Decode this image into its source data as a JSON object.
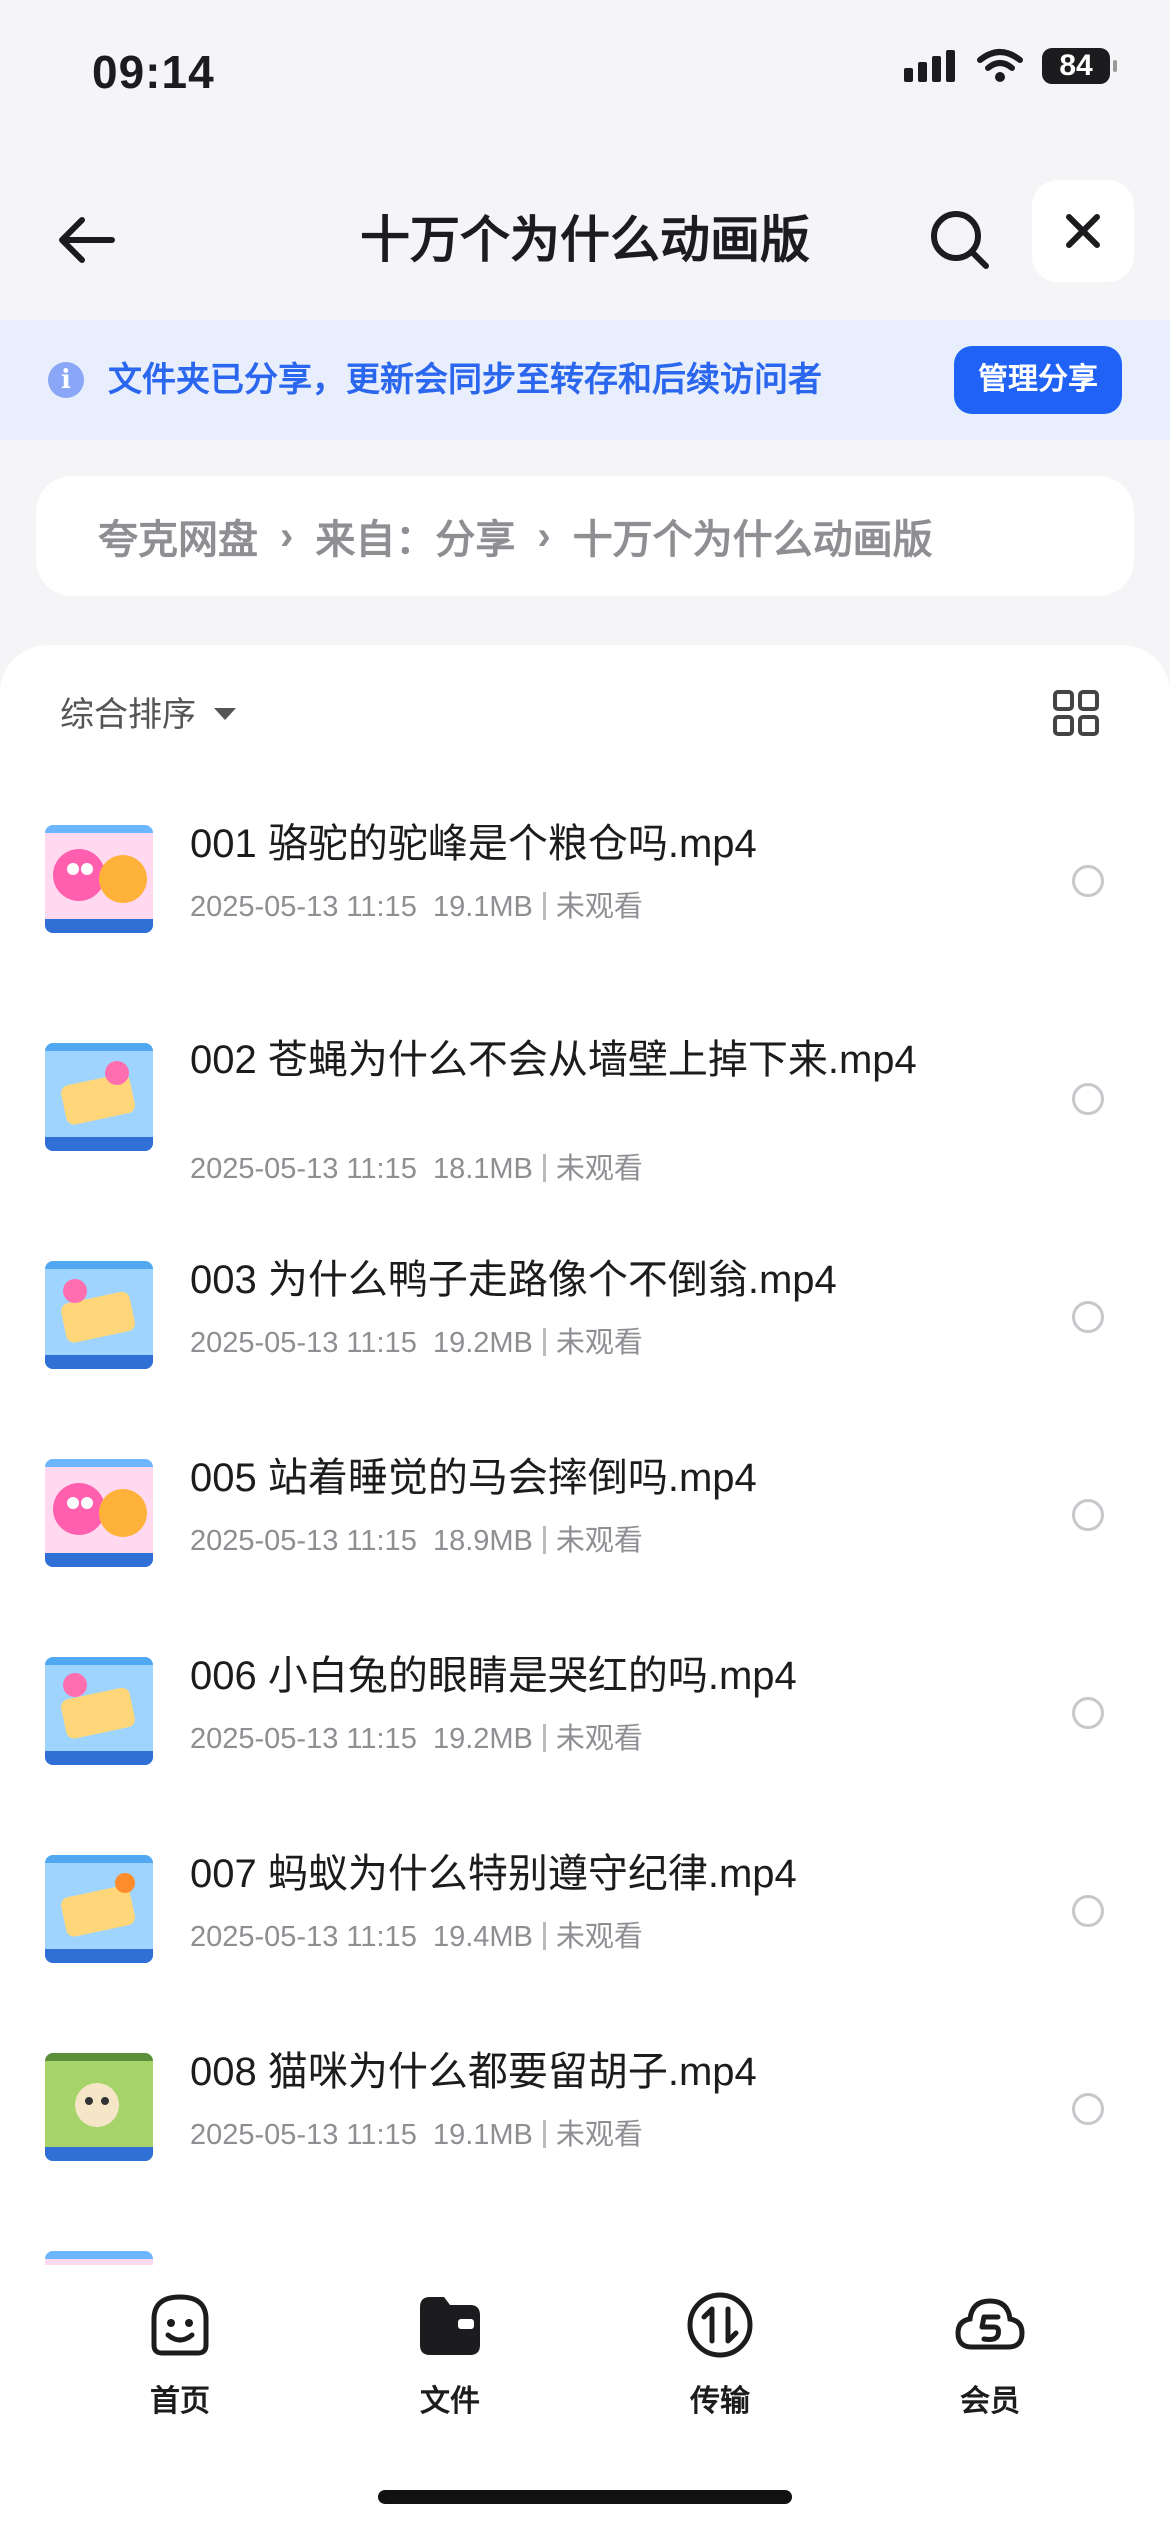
{
  "status_bar": {
    "time": "09:14",
    "battery": "84"
  },
  "nav": {
    "title": "十万个为什么动画版"
  },
  "banner": {
    "text": "文件夹已分享，更新会同步至转存和后续访问者",
    "button": "管理分享",
    "info_glyph": "i"
  },
  "breadcrumb": [
    "夸克网盘",
    "来自：分享",
    "十万个为什么动画版"
  ],
  "sort": {
    "label": "综合排序"
  },
  "files": [
    {
      "name": "001 骆驼的驼峰是个粮仓吗.mp4",
      "date": "2025-05-13 11:15",
      "size": "19.1MB",
      "status": "未观看",
      "thumb": "pink"
    },
    {
      "name": "002 苍蝇为什么不会从墙壁上掉下来.mp4",
      "date": "2025-05-13 11:15",
      "size": "18.1MB",
      "status": "未观看",
      "thumb": "blue"
    },
    {
      "name": "003 为什么鸭子走路像个不倒翁.mp4",
      "date": "2025-05-13 11:15",
      "size": "19.2MB",
      "status": "未观看",
      "thumb": "blue"
    },
    {
      "name": "005 站着睡觉的马会摔倒吗.mp4",
      "date": "2025-05-13 11:15",
      "size": "18.9MB",
      "status": "未观看",
      "thumb": "pink"
    },
    {
      "name": "006 小白兔的眼睛是哭红的吗.mp4",
      "date": "2025-05-13 11:15",
      "size": "19.2MB",
      "status": "未观看",
      "thumb": "blue"
    },
    {
      "name": "007 蚂蚁为什么特别遵守纪律.mp4",
      "date": "2025-05-13 11:15",
      "size": "19.4MB",
      "status": "未观看",
      "thumb": "blue"
    },
    {
      "name": "008 猫咪为什么都要留胡子.mp4",
      "date": "2025-05-13 11:15",
      "size": "19.1MB",
      "status": "未观看",
      "thumb": "green"
    }
  ],
  "tabs": [
    {
      "label": "首页",
      "icon": "home-face-icon"
    },
    {
      "label": "文件",
      "icon": "folder-icon"
    },
    {
      "label": "传输",
      "icon": "transfer-icon"
    },
    {
      "label": "会员",
      "icon": "member-cloud-icon"
    }
  ]
}
